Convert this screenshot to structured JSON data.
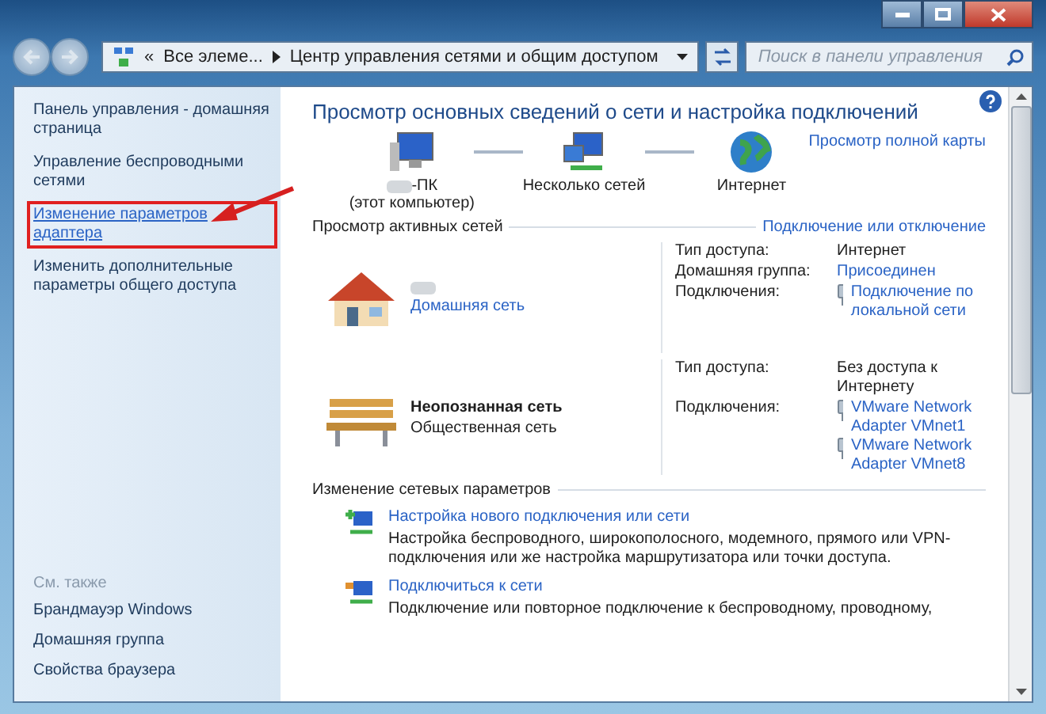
{
  "address_bar": {
    "overflow": "«",
    "crumbs": [
      "Все элеме...",
      "Центр управления сетями и общим доступом"
    ]
  },
  "search": {
    "placeholder": "Поиск в панели управления"
  },
  "sidebar": {
    "links": [
      {
        "label": "Панель управления - домашняя страница",
        "link": false,
        "highlighted": false
      },
      {
        "label": "Управление беспроводными сетями",
        "link": false,
        "highlighted": false
      },
      {
        "label": "Изменение параметров адаптера",
        "link": true,
        "highlighted": true
      },
      {
        "label": "Изменить дополнительные параметры общего доступа",
        "link": false,
        "highlighted": false
      }
    ],
    "see_also_title": "См. также",
    "see_also": [
      "Брандмауэр Windows",
      "Домашняя группа",
      "Свойства браузера"
    ]
  },
  "main": {
    "title": "Просмотр основных сведений о сети и настройка подключений",
    "map": {
      "nodes": [
        {
          "kind": "computer",
          "label": "-ПК",
          "name_hidden": true,
          "sublabel": "(этот компьютер)"
        },
        {
          "kind": "networks",
          "label": "Несколько сетей",
          "name_hidden": false
        },
        {
          "kind": "globe",
          "label": "Интернет",
          "name_hidden": false
        }
      ],
      "full_map_link": "Просмотр полной карты"
    },
    "active": {
      "title": "Просмотр активных сетей",
      "link": "Подключение или отключение",
      "networks": [
        {
          "kind": "home",
          "name_hidden": true,
          "type": "Домашняя сеть",
          "type_link": true,
          "props": [
            {
              "kind": "text",
              "label": "Тип доступа:",
              "value": "Интернет"
            },
            {
              "kind": "link",
              "label": "Домашняя группа:",
              "value": "Присоединен"
            },
            {
              "kind": "connections",
              "label": "Подключения:",
              "items": [
                "Подключение по локальной сети"
              ]
            }
          ]
        },
        {
          "kind": "public",
          "name": "Неопознанная сеть",
          "name_hidden": false,
          "type": "Общественная сеть",
          "type_link": false,
          "props": [
            {
              "kind": "text",
              "label": "Тип доступа:",
              "value": "Без доступа к Интернету"
            },
            {
              "kind": "connections",
              "label": "Подключения:",
              "items": [
                "VMware Network Adapter VMnet1",
                "VMware Network Adapter VMnet8"
              ]
            }
          ]
        }
      ]
    },
    "tasks": {
      "title": "Изменение сетевых параметров",
      "items": [
        {
          "kind": "new",
          "title": "Настройка нового подключения или сети",
          "desc": "Настройка беспроводного, широкополосного, модемного, прямого или VPN-подключения или же настройка маршрутизатора или точки доступа."
        },
        {
          "kind": "connect",
          "title": "Подключиться к сети",
          "desc": "Подключение или повторное подключение к беспроводному, проводному,"
        }
      ]
    }
  }
}
